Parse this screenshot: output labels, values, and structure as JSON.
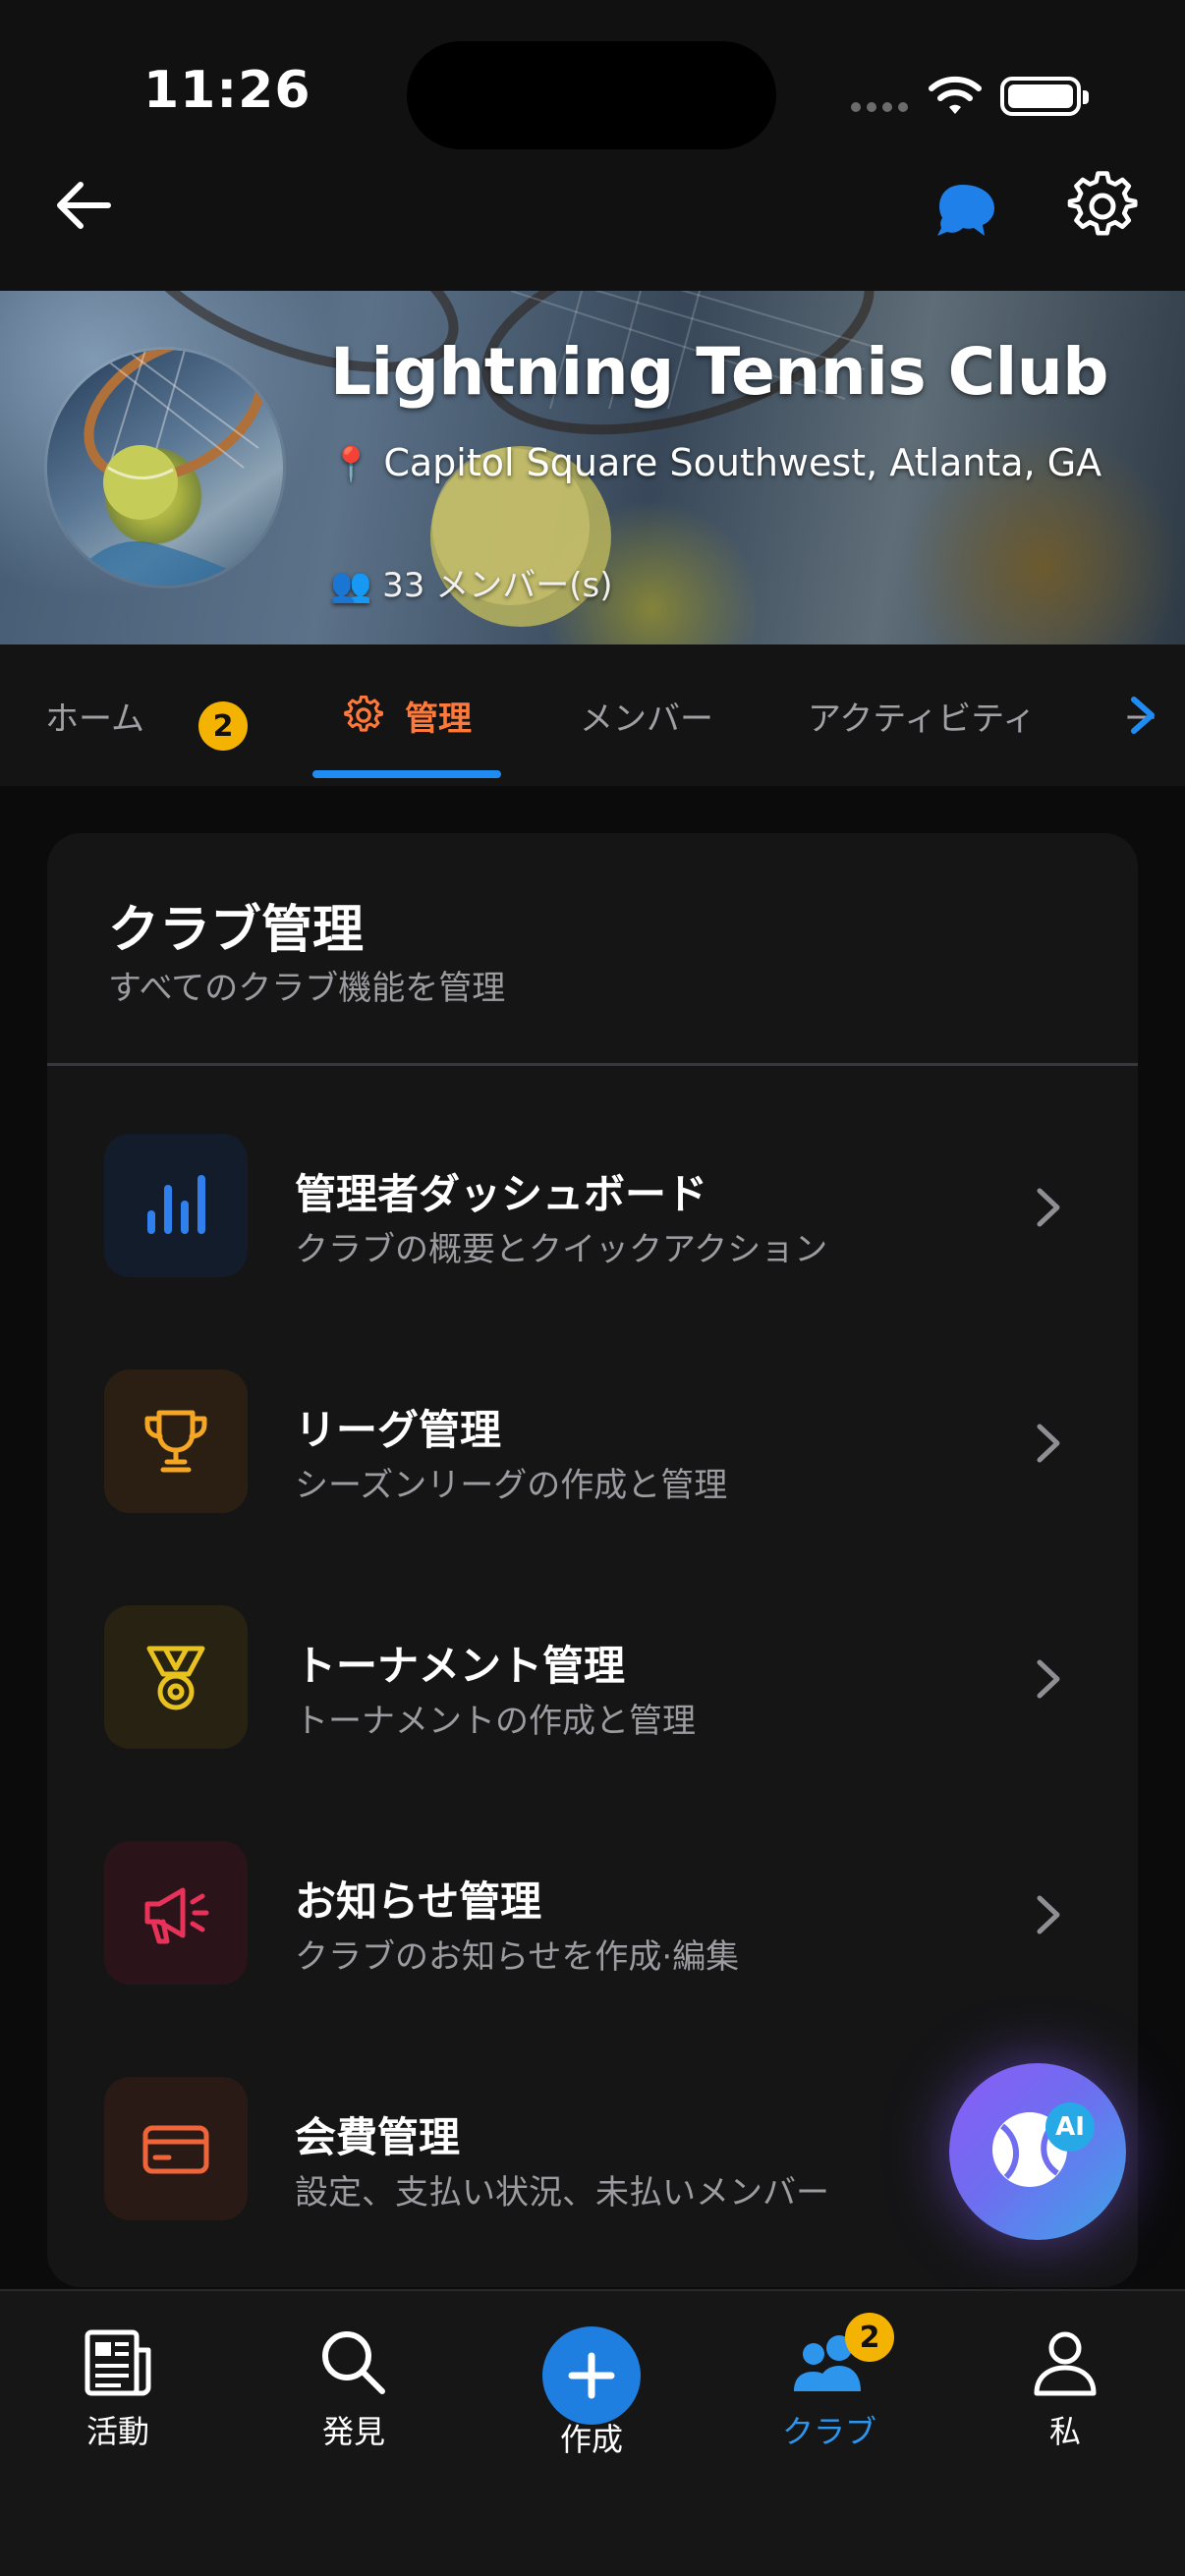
{
  "status_bar": {
    "time": "11:26"
  },
  "header": {
    "back_icon": "arrow-left-icon",
    "chat_icon": "chat-bubbles-icon",
    "settings_icon": "gear-icon"
  },
  "club": {
    "name": "Lightning Tennis Club",
    "location_icon": "📍",
    "location": "Capitol Square Southwest, Atlanta, GA",
    "members_icon": "👥",
    "members": "33 メンバー(s)"
  },
  "tabs": {
    "home": "ホーム",
    "home_badge": "2",
    "manage": "管理",
    "members": "メンバー",
    "activity": "アクティビティ",
    "more": "ー"
  },
  "card": {
    "title": "クラブ管理",
    "subtitle": "すべてのクラブ機能を管理",
    "items": [
      {
        "title": "管理者ダッシュボード",
        "subtitle": "クラブの概要とクイックアクション",
        "icon": "bar-chart-icon",
        "color": "#2f80ed",
        "bg": "#121c2b"
      },
      {
        "title": "リーグ管理",
        "subtitle": "シーズンリーグの作成と管理",
        "icon": "trophy-icon",
        "color": "#f5a623",
        "bg": "#2a1f12"
      },
      {
        "title": "トーナメント管理",
        "subtitle": "トーナメントの作成と管理",
        "icon": "medal-icon",
        "color": "#e8c21f",
        "bg": "#272212"
      },
      {
        "title": "お知らせ管理",
        "subtitle": "クラブのお知らせを作成·編集",
        "icon": "megaphone-icon",
        "color": "#e8325a",
        "bg": "#2a1419"
      },
      {
        "title": "会費管理",
        "subtitle": "設定、支払い状況、未払いメンバー",
        "icon": "credit-card-icon",
        "color": "#f0643a",
        "bg": "#2a1a15"
      }
    ]
  },
  "fab": {
    "label": "AI"
  },
  "bottom_nav": {
    "activity": "活動",
    "discover": "発見",
    "create": "作成",
    "clubs": "クラブ",
    "clubs_badge": "2",
    "me": "私"
  },
  "colors": {
    "accent_orange": "#ff7a3a",
    "accent_blue": "#1e8cf2",
    "badge_yellow": "#f5b301"
  }
}
